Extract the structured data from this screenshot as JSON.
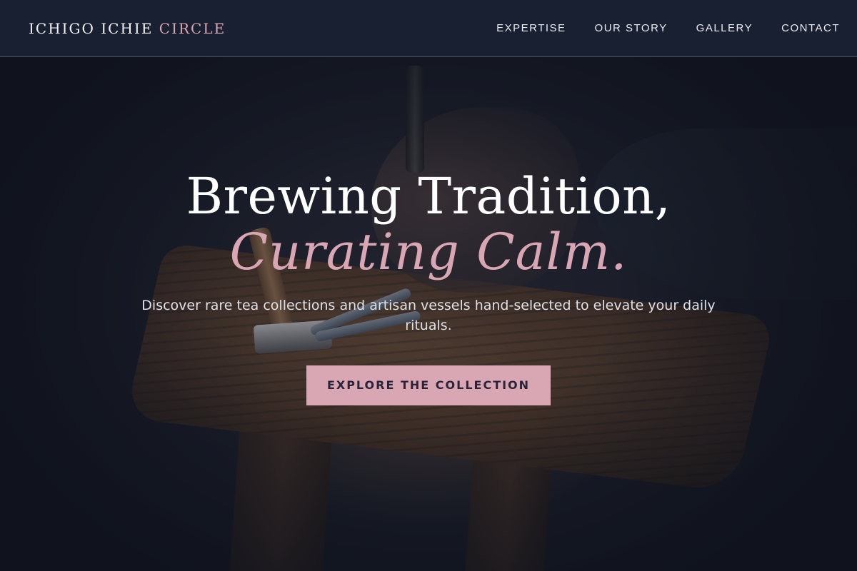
{
  "header": {
    "logo_main": "ICHIGO ICHIE ",
    "logo_accent": "CIRCLE",
    "nav": [
      {
        "label": "EXPERTISE"
      },
      {
        "label": "OUR STORY"
      },
      {
        "label": "GALLERY"
      },
      {
        "label": "CONTACT"
      }
    ]
  },
  "hero": {
    "title_line1": "Brewing Tradition,",
    "title_line2": "Curating Calm.",
    "subtitle": "Discover rare tea collections and artisan vessels hand-selected to elevate your daily rituals.",
    "cta_label": "EXPLORE THE COLLECTION"
  },
  "colors": {
    "accent_pink": "#d9a7b3",
    "header_bg": "#1a2234",
    "button_text": "#2b2338"
  },
  "icons": {
    "background": "craftsman-workbench-photo"
  }
}
